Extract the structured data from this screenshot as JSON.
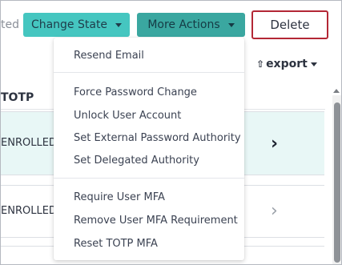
{
  "toolbar": {
    "selected_fragment": "ted",
    "change_state_label": "Change State",
    "more_actions_label": "More Actions",
    "delete_label": "Delete"
  },
  "export": {
    "label": "export"
  },
  "table": {
    "column_header": "TOTP",
    "rows": [
      {
        "status": "ENROLLED"
      },
      {
        "status": "ENROLLED"
      }
    ]
  },
  "more_actions_menu": {
    "groups": [
      [
        "Resend Email"
      ],
      [
        "Force Password Change",
        "Unlock User Account",
        "Set External Password Authority",
        "Set Delegated Authority"
      ],
      [
        "Require User MFA",
        "Remove User MFA Requirement",
        "Reset TOTP MFA"
      ]
    ]
  },
  "colors": {
    "change_state_bg": "#45c6c0",
    "more_actions_bg": "#3aa7a0",
    "delete_border": "#b32735",
    "selected_row_bg": "#e8f7f6"
  },
  "icons": [
    "caret-down-icon",
    "upload-icon",
    "chevron-right-icon"
  ]
}
